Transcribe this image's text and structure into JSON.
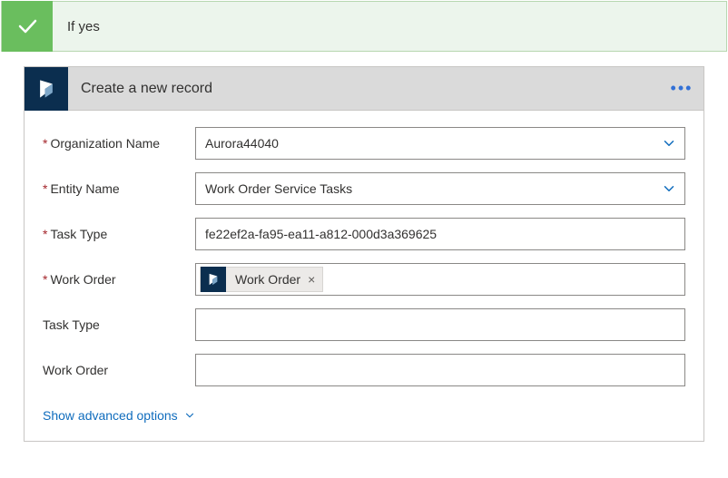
{
  "condition": {
    "title": "If yes"
  },
  "action": {
    "title": "Create a new record"
  },
  "fields": {
    "org": {
      "label": "Organization Name",
      "value": "Aurora44040"
    },
    "entity": {
      "label": "Entity Name",
      "value": "Work Order Service Tasks"
    },
    "taskTypeReq": {
      "label": "Task Type",
      "value": "fe22ef2a-fa95-ea11-a812-000d3a369625"
    },
    "workOrderReq": {
      "label": "Work Order",
      "chip": "Work Order"
    },
    "taskTypeOpt": {
      "label": "Task Type",
      "value": ""
    },
    "workOrderOpt": {
      "label": "Work Order",
      "value": ""
    }
  },
  "advanced": {
    "label": "Show advanced options"
  }
}
